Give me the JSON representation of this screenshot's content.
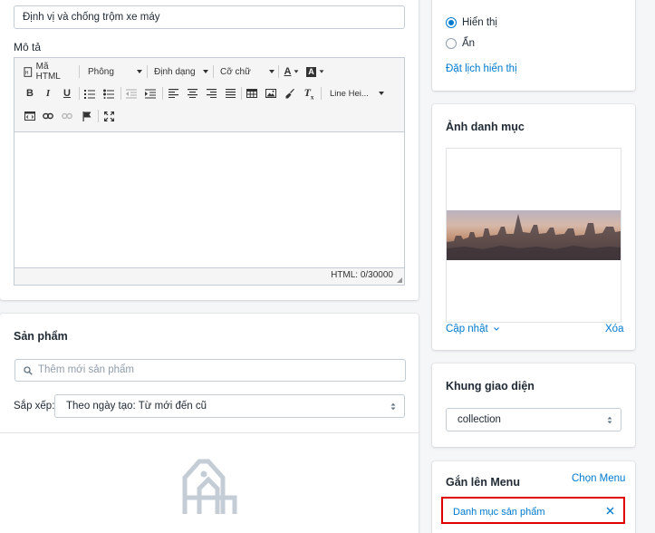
{
  "category": {
    "name_value": "Định vị và chống trộm xe máy",
    "description_label": "Mô tả"
  },
  "editor": {
    "html_btn": "Mã HTML",
    "font_select": "Phông",
    "format_select": "Định dạng",
    "size_select": "Cỡ chữ",
    "line_height_select": "Line Hei...",
    "counter": "HTML: 0/30000"
  },
  "products": {
    "title": "Sản phẩm",
    "search_placeholder": "Thêm mới sản phẩm",
    "sort_label": "Sắp xếp:",
    "sort_value": "Theo ngày tạo: Từ mới đến cũ"
  },
  "visibility": {
    "option_show": "Hiển thị",
    "option_hide": "Ẩn",
    "selected": "show",
    "schedule_link": "Đặt lịch hiển thị"
  },
  "category_image": {
    "title": "Ảnh danh mục",
    "update_link": "Cập nhật",
    "delete_link": "Xóa"
  },
  "template": {
    "title": "Khung giao diện",
    "value": "collection"
  },
  "menu": {
    "title": "Gắn lên Menu",
    "choose_link": "Chọn Menu",
    "item_label": "Danh mục sản phẩm",
    "highlight_color": "#e00000"
  }
}
